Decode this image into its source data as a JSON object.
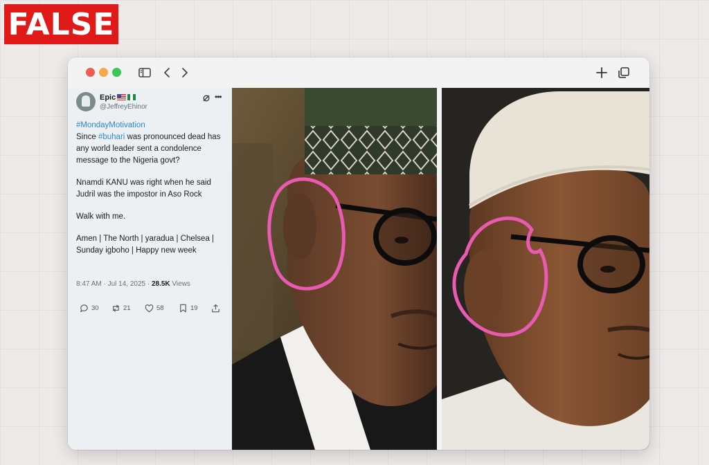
{
  "badge": {
    "label": "FALSE",
    "color": "#e01919"
  },
  "browser": {
    "controls": [
      "close-dot",
      "minimize-dot",
      "zoom-dot"
    ],
    "toolbar_icons": [
      "sidebar-icon",
      "back-icon",
      "forward-icon",
      "new-tab-icon",
      "tabs-overview-icon"
    ]
  },
  "tweet": {
    "display_name": "Epic",
    "handle": "@JeffreyEhinor",
    "hashtag_line": "#MondayMotivation",
    "line1_prefix": "Since ",
    "line1_hashtag": "#buhari",
    "line1_rest": " was pronounced dead has any world leader sent a condolence message to the Nigeria govt?",
    "paragraph2": "Nnamdi KANU was right when he said Judril was the impostor in Aso Rock",
    "paragraph3": "Walk with me.",
    "paragraph4": "Amen | The North | yaradua | Chelsea | Sunday igboho | Happy new week",
    "timestamp": "8:47 AM · Jul 14, 2025 · ",
    "views_count": "28.5K",
    "views_label": " Views",
    "replies": "30",
    "reposts": "21",
    "likes": "58",
    "bookmarks": "19",
    "hashtag_color": "#2d86d3"
  },
  "image": {
    "panels": [
      "left-portrait",
      "right-portrait"
    ],
    "annotation_color": "#e85bb0"
  }
}
